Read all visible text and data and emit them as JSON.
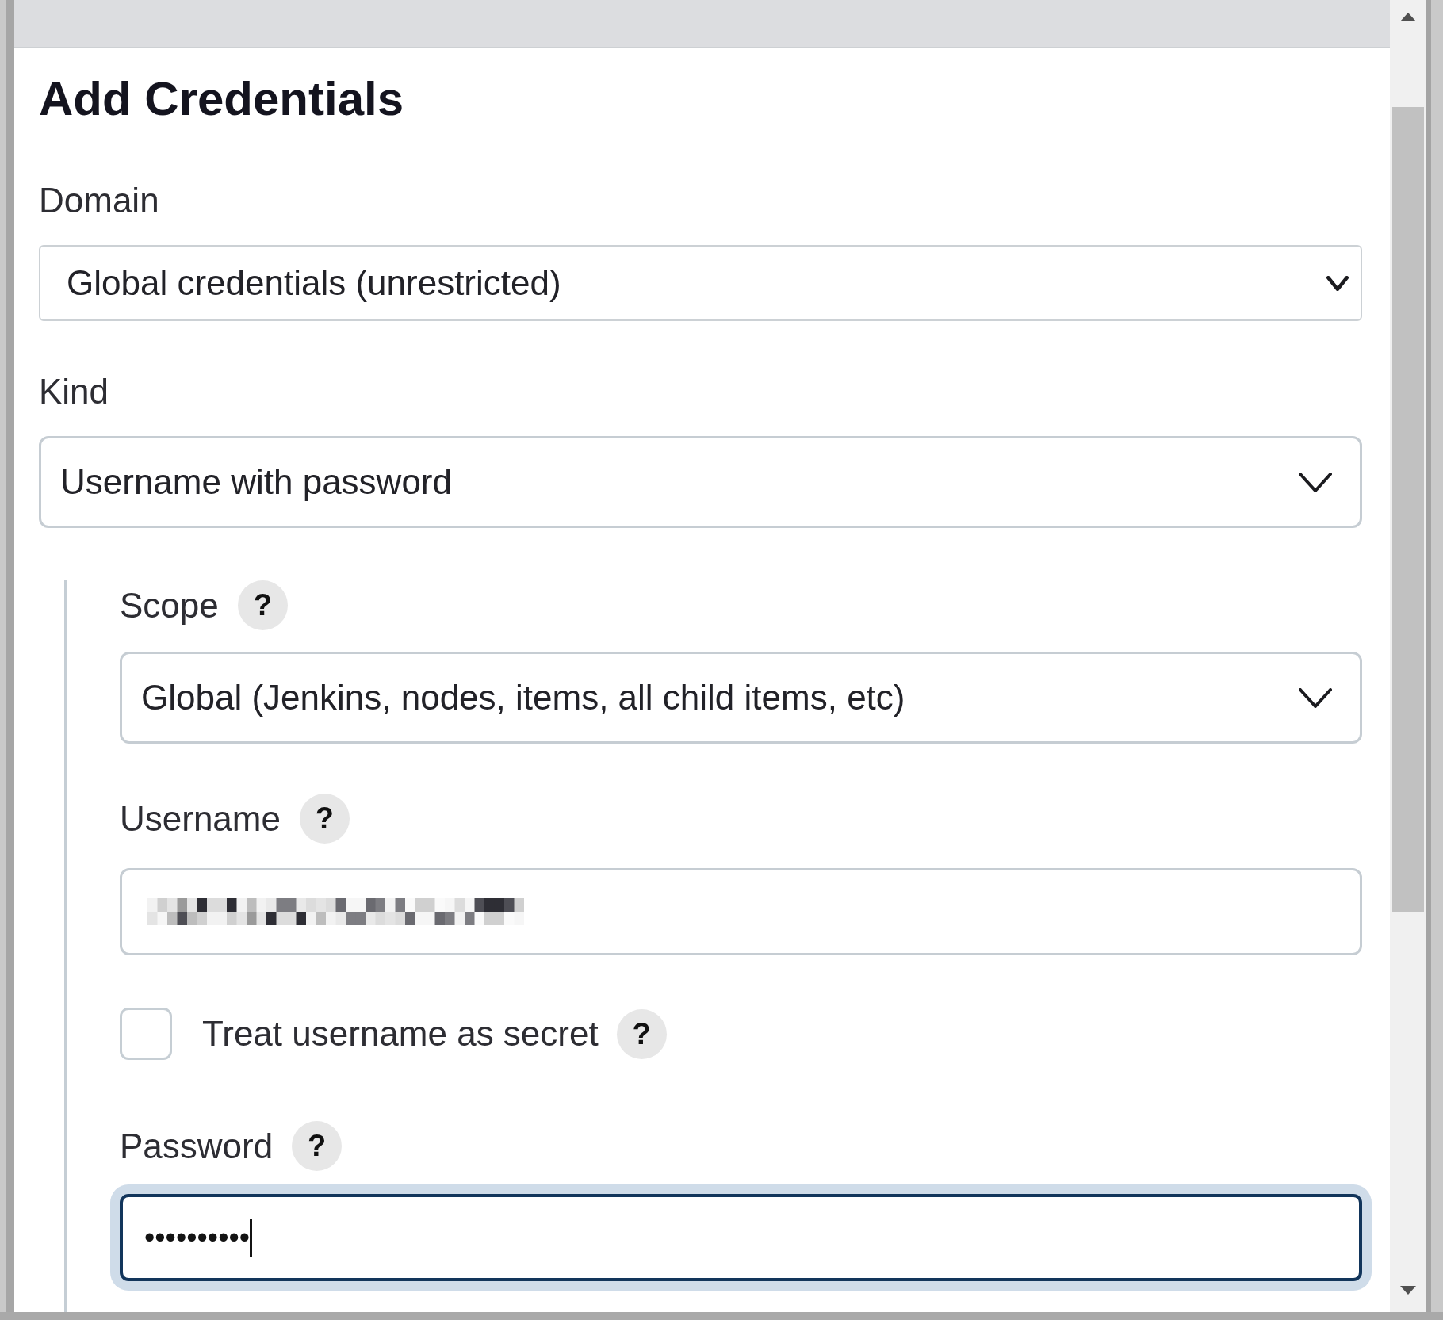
{
  "header": {
    "title": "Add Credentials"
  },
  "fields": [
    {
      "kind": "dropdown",
      "label": "Domain",
      "value": "Global credentials (unrestricted)"
    },
    {
      "kind": "select",
      "label": "Kind",
      "value": "Username with password"
    }
  ],
  "credential_fields": [
    {
      "kind": "select",
      "label": "Scope",
      "help": "?",
      "value": "Global (Jenkins, nodes, items, all child items, etc)"
    },
    {
      "kind": "text",
      "label": "Username",
      "help": "?",
      "redacted": true
    },
    {
      "kind": "checkbox",
      "label": "Treat username as secret",
      "help": "?",
      "checked": false
    },
    {
      "kind": "password",
      "label": "Password",
      "help": "?",
      "value": "••••••••••",
      "focused": true
    }
  ]
}
